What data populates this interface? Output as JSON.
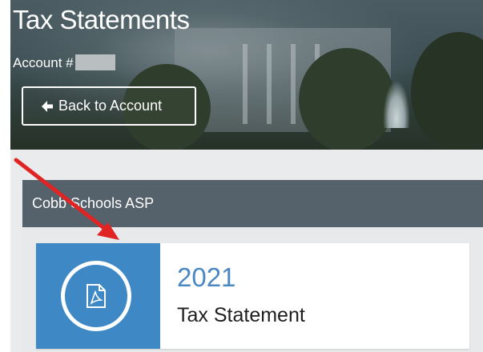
{
  "page": {
    "title": "Tax Statements",
    "account_label": "Account #"
  },
  "header": {
    "back_button_label": "Back to Account",
    "back_icon": "arrow-left-icon"
  },
  "panel": {
    "title": "Cobb Schools ASP"
  },
  "statement": {
    "year": "2021",
    "label": "Tax Statement",
    "icon": "pdf-file-icon"
  },
  "annotation": {
    "arrow_color": "#e02424"
  },
  "colors": {
    "panel_header": "#55626c",
    "icon_tile": "#3e88c5",
    "year_text": "#4a87c3"
  }
}
